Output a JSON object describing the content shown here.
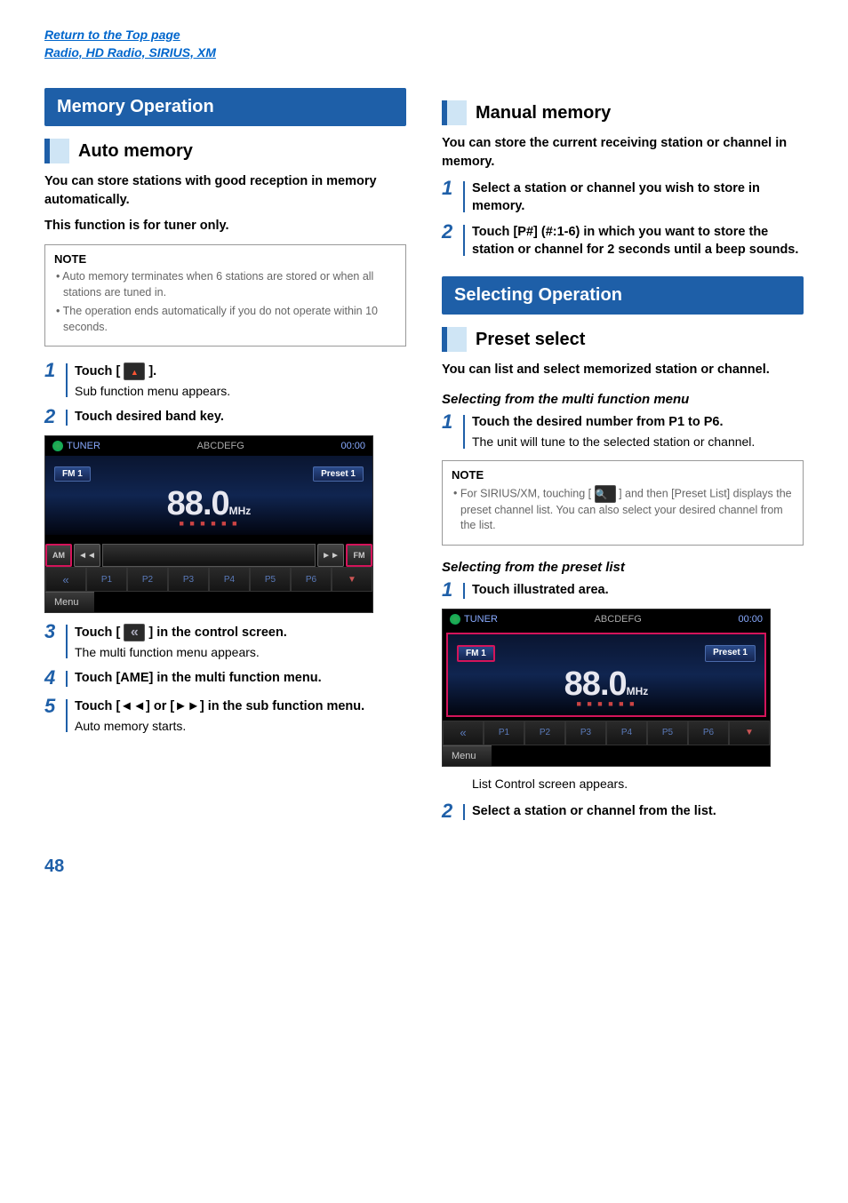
{
  "topLinks": {
    "return": "Return to the Top page",
    "section": "Radio, HD Radio, SIRIUS, XM"
  },
  "left": {
    "header1": "Memory Operation",
    "sub1": "Auto memory",
    "auto_text1": "You can store stations with good reception in memory automatically.",
    "auto_text2": "This function is for tuner only.",
    "note_title": "NOTE",
    "note1": "Auto memory terminates when 6 stations are stored or when all stations are tuned in.",
    "note2": "The operation ends automatically if you do not operate within 10 seconds.",
    "step1_a": "Touch [ ",
    "step1_b": " ].",
    "step1_desc": "Sub function menu appears.",
    "step2": "Touch desired band key.",
    "step3_a": "Touch [ ",
    "step3_b": " ] in the control screen.",
    "step3_desc": "The multi function menu appears.",
    "step4": "Touch [AME] in the multi function menu.",
    "step5": "Touch [◄◄] or [►►] in the sub function menu.",
    "step5_desc": "Auto memory starts."
  },
  "right": {
    "sub1": "Manual memory",
    "manual_text": "You can store the current receiving station or channel in memory.",
    "mstep1": "Select a station or channel you wish to store in memory.",
    "mstep2": "Touch [P#] (#:1-6) in which you want to store the station or channel for 2 seconds until a beep sounds.",
    "header2": "Selecting Operation",
    "sub2": "Preset select",
    "preset_text": "You can list and select memorized station or channel.",
    "italic1": "Selecting from the multi function menu",
    "pstep1": "Touch the desired number from P1 to P6.",
    "pstep1_desc": "The unit will tune to the selected station or channel.",
    "note_title": "NOTE",
    "note1a": "For SIRIUS/XM, touching [ ",
    "note1b": " ] and then [Preset List] displays the preset channel list. You can also select your desired channel from the list.",
    "italic2": "Selecting from the preset list",
    "lstep1": "Touch illustrated area.",
    "lstep1_desc": "List Control screen appears.",
    "lstep2": "Select a station or channel from the list."
  },
  "screenshot": {
    "tuner": "TUNER",
    "label": "ABCDEFG",
    "time": "00:00",
    "band": "FM 1",
    "preset": "Preset 1",
    "freq_main": "88.0",
    "freq_unit": "MHz",
    "am": "AM",
    "fm": "FM",
    "p1": "P1",
    "p2": "P2",
    "p3": "P3",
    "p4": "P4",
    "p5": "P5",
    "p6": "P6",
    "menu": "Menu"
  },
  "pageNum": "48"
}
